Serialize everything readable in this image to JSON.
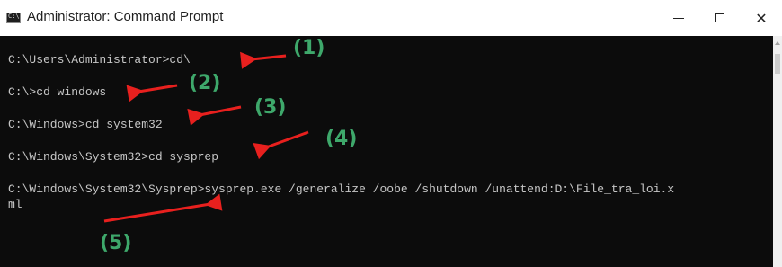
{
  "window": {
    "title": "Administrator: Command Prompt",
    "controls": {
      "minimize": "—",
      "close": "✕"
    }
  },
  "console": {
    "lines": [
      "C:\\Users\\Administrator>cd\\",
      "C:\\>cd windows",
      "C:\\Windows>cd system32",
      "C:\\Windows\\System32>cd sysprep",
      "C:\\Windows\\System32\\Sysprep>sysprep.exe /generalize /oobe /shutdown /unattend:D:\\File_tra_loi.x",
      "ml"
    ]
  },
  "annotations": {
    "color": "#3ea86b",
    "arrow_color": "#e8201e",
    "labels": [
      "(1)",
      "(2)",
      "(3)",
      "(4)",
      "(5)"
    ]
  }
}
